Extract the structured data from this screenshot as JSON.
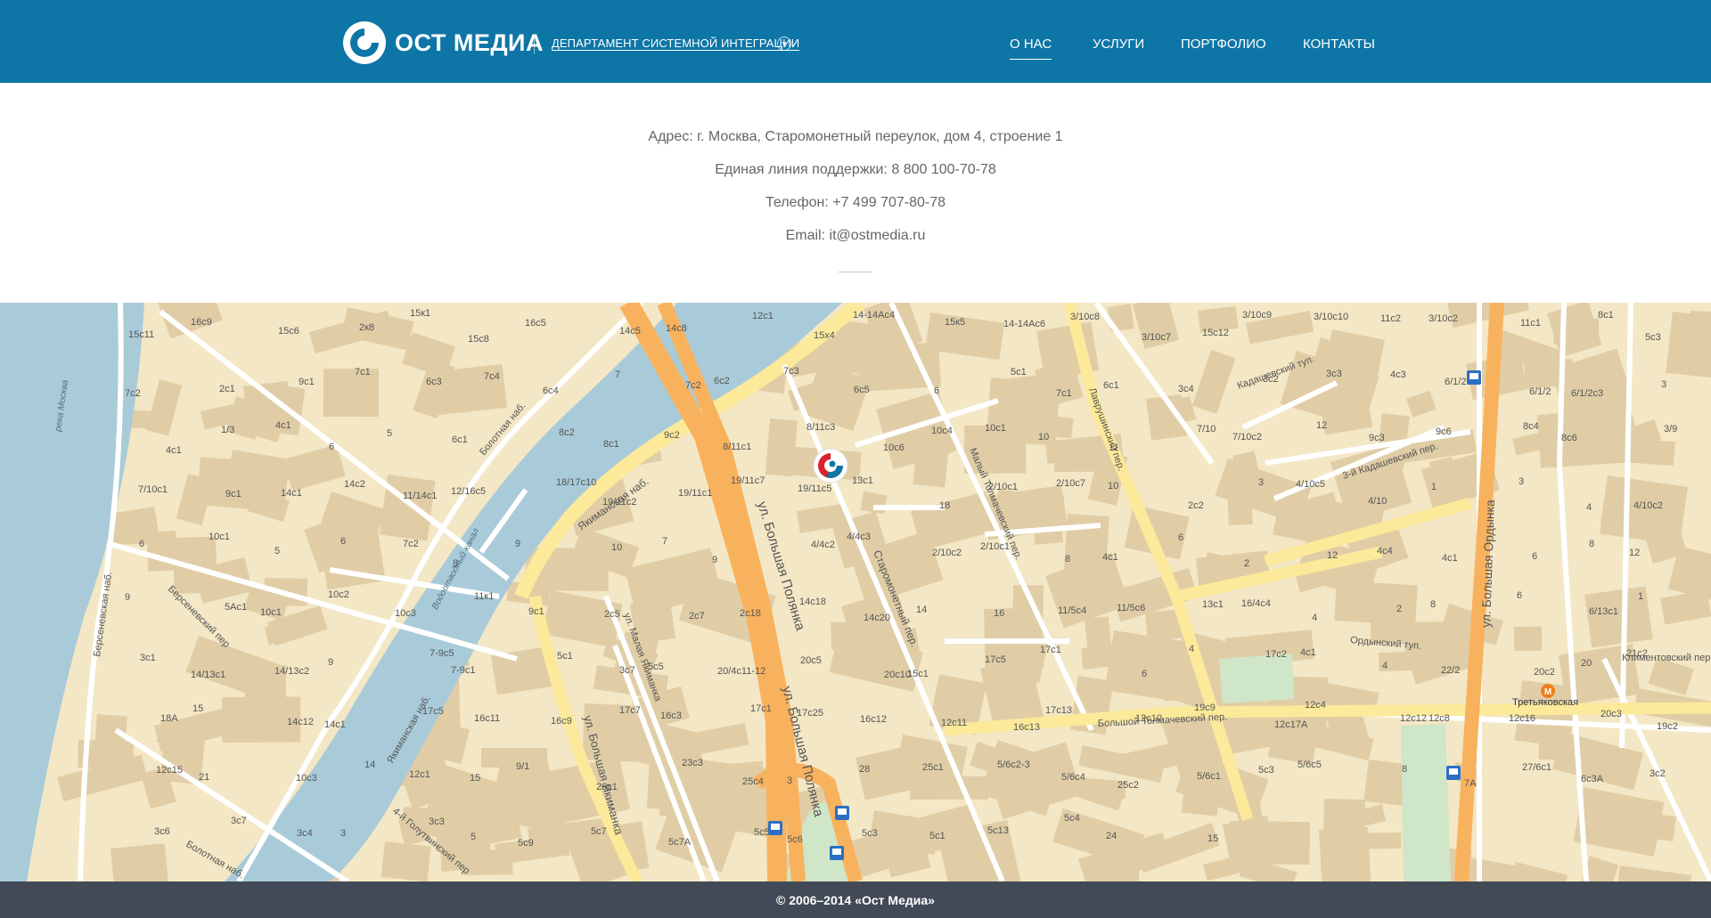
{
  "header": {
    "logo_text": "ОСТ МЕДИА",
    "department": "ДЕПАРТАМЕНТ СИСТЕМНОЙ ИНТЕГРАЦИИ",
    "nav": {
      "about": "О НАС",
      "services": "УСЛУГИ",
      "portfolio": "ПОРТФОЛИО",
      "contacts": "КОНТАКТЫ"
    },
    "active_nav": "about"
  },
  "contacts": {
    "address": "Адрес: г. Москва, Старомонетный переулок, дом 4, строение 1",
    "support": "Единая линия поддержки: 8 800 100-70-78",
    "phone": "Телефон: +7 499 707-80-78",
    "email": "Email: it@ostmedia.ru"
  },
  "map": {
    "streets": {
      "bolshaya_polyanka": "ул. Большая Полянка",
      "bolshaya_ordynka": "ул. Большая Ордынка",
      "bolshaya_yakimanka": "ул. Большая Якиманка",
      "malaya_yakimanka": "ул. Малая Якиманка",
      "staromonetny": "Старомонетный пер.",
      "maly_tolmachevsky": "Малый Толмачевский пер.",
      "lavrushinsky": "Лаврушинский пер.",
      "bolshoy_tolmachevsky": "Большой Толмачевский пер.",
      "ordynsky": "Ордынский туп.",
      "klimentovsky": "Климентовский пер.",
      "kadashevsky": "Кадашевский туп.",
      "third_kadashevsky": "3-й Кадашевский пер.",
      "yakimanskaya": "Якиманская наб.",
      "yakimanskaya_2": "Якиманская наб.",
      "bolotnaya": "Болотная наб.",
      "bolotnaya_2": "Болотная наб.",
      "bersenevskaya": "Берсеневская наб.",
      "bersenevsky": "Берсеневский пер",
      "golutvinsky": "4-й Голутвинский пер",
      "vodootvodny": "Водоотводный канал",
      "moskva_river": "река Москва",
      "tretyakovskaya": "Третьяковская"
    },
    "house_labels": [
      "15с11",
      "16с9",
      "15с6",
      "2к8",
      "15к1",
      "15с8",
      "16с5",
      "14с5",
      "14с8",
      "12с1",
      "15х4",
      "14-14Ас4",
      "15к5",
      "14-14Ас6",
      "3/10с8",
      "3/10с7",
      "15с12",
      "3/10с9",
      "3/10с10",
      "11с2",
      "3/10с2",
      "11с1",
      "8с1",
      "5с3",
      "7с2",
      "2с1",
      "9с1",
      "7с1",
      "6с3",
      "7с4",
      "6с4",
      "7",
      "7с2",
      "6с2",
      "7с3",
      "6с5",
      "6",
      "5с1",
      "7с1",
      "6с1",
      "3с4",
      "3с2",
      "3с3",
      "4с3",
      "6/1/2с1",
      "6/1/2",
      "6/1/2с3",
      "3",
      "4с1",
      "1/3",
      "4с1",
      "6",
      "5",
      "6с1",
      "8с2",
      "8с1",
      "9с2",
      "8/11с1",
      "8/11с3",
      "10с6",
      "10с4",
      "10с1",
      "10",
      "11",
      "7/10",
      "7/10с2",
      "12",
      "9с3",
      "9с6",
      "8с4",
      "8с6",
      "3/9",
      "7/10с1",
      "9с1",
      "14с1",
      "14с2",
      "11/14с1",
      "12/16с5",
      "18/17с10",
      "19/11с2",
      "19/11с1",
      "19/11с7",
      "19/11с5",
      "13с1",
      "18",
      "2/10с1",
      "2/10с7",
      "10",
      "2с2",
      "3",
      "4/10с5",
      "4/10",
      "1",
      "3",
      "4",
      "4/10с2",
      "6",
      "10с1",
      "5",
      "6",
      "7с2",
      "8",
      "9",
      "10",
      "7",
      "9",
      "4/4с2",
      "4/4с3",
      "2/10с2",
      "2/10с1",
      "8",
      "4с1",
      "6",
      "2",
      "12",
      "4с4",
      "4с1",
      "6",
      "8",
      "12",
      "9",
      "5Ас1",
      "10с1",
      "10с2",
      "10с3",
      "11к1",
      "9с1",
      "2с5",
      "2с7",
      "2с18",
      "14с18",
      "14с20",
      "14",
      "16",
      "11/5с4",
      "11/5с6",
      "13с1",
      "16/4с4",
      "4",
      "2",
      "8",
      "6",
      "6/13с1",
      "1",
      "3с1",
      "14/13с1",
      "14/13с2",
      "9",
      "7-9с5",
      "7-9с1",
      "5с1",
      "3с7",
      "5с5",
      "20/4с11-12",
      "20с5",
      "20с10",
      "15с1",
      "17с5",
      "17с1",
      "6",
      "4",
      "17с2",
      "4с1",
      "4",
      "22/2",
      "20с2",
      "20",
      "21с2",
      "18А",
      "15",
      "14с12",
      "14с1",
      "17с5",
      "16с11",
      "16с9",
      "17с7",
      "16с3",
      "17с1",
      "17с25",
      "16с12",
      "12с11",
      "16с13",
      "17с13",
      "12с10",
      "19с9",
      "12с17А",
      "12с4",
      "12с12",
      "12с8",
      "12с16",
      "20с3",
      "19с2",
      "12с15",
      "21",
      "10с3",
      "14",
      "12с1",
      "15",
      "9/1",
      "26с1",
      "23с3",
      "25с4",
      "3",
      "28",
      "25с1",
      "5/6с2-3",
      "5/6с4",
      "25с2",
      "5/6с1",
      "5с3",
      "5/6с5",
      "8",
      "7А",
      "27/6с1",
      "6с3А",
      "3с2",
      "3с6",
      "3с7",
      "3с4",
      "3",
      "3с3",
      "5",
      "5с9",
      "5с7",
      "5с7А",
      "5с5",
      "5с6",
      "5с3",
      "5с1",
      "5с13",
      "5с4",
      "24",
      "15"
    ]
  },
  "footer": {
    "copyright": "© 2006–2014 «Ост Медиа»"
  },
  "colors": {
    "header_bg": "#0d76a7",
    "footer_bg": "#414a56",
    "map_land": "#f3e7c5",
    "map_building": "#e0cda6",
    "map_water": "#a9cbd9",
    "map_major_road": "#f8b25e",
    "map_secondary_road": "#fcea9a",
    "map_park": "#cfe6c8",
    "marker_red": "#d9232f",
    "marker_blue": "#0d76a7",
    "metro_orange": "#ef7e1c",
    "bus_stop_blue": "#2b6fc4"
  }
}
